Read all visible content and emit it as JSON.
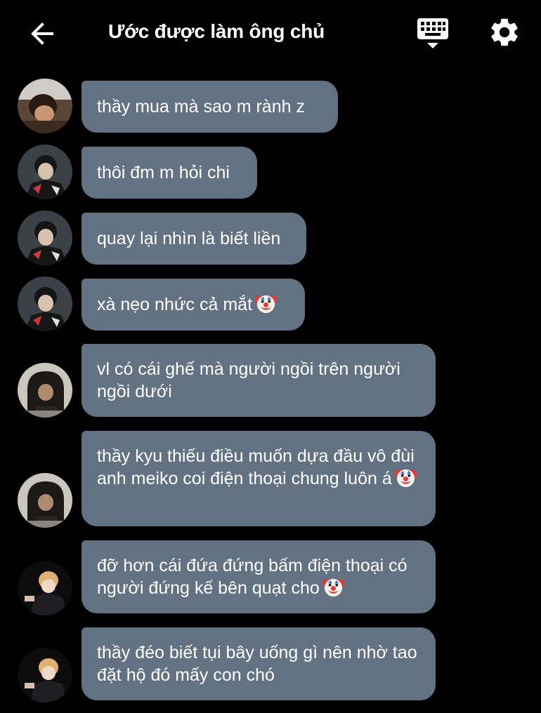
{
  "header": {
    "title": "Ước được làm ông chủ",
    "back_icon": "arrow-left-icon",
    "keyboard_icon": "keyboard-icon",
    "settings_icon": "gear-icon"
  },
  "colors": {
    "background": "#000000",
    "bubble": "#637282",
    "text": "#ffffff"
  },
  "messages": [
    {
      "text": "thầy mua mà sao m rành z",
      "emoji": "",
      "avatar": "avatar-user-1"
    },
    {
      "text": "thôi đm m hỏi chi",
      "emoji": "",
      "avatar": "avatar-user-2"
    },
    {
      "text": "quay lại nhìn là biết liền",
      "emoji": "",
      "avatar": "avatar-user-2"
    },
    {
      "text": "xà nẹo nhức cả mắt",
      "emoji": "clown-face-icon",
      "avatar": "avatar-user-2"
    },
    {
      "text": "vl có cái ghế mà người ngồi trên người ngồi dưới",
      "emoji": "",
      "avatar": "avatar-user-3"
    },
    {
      "text": "thầy kyu thiếu điều muốn dựa đầu vô đùi anh meiko coi điện thoại chung luôn á",
      "emoji": "clown-face-icon",
      "avatar": "avatar-user-3"
    },
    {
      "text": "đỡ hơn cái đứa đứng bấm điện thoại có người đứng kế bên quạt cho",
      "emoji": "clown-face-icon",
      "avatar": "avatar-user-4"
    },
    {
      "text": "thầy đéo biết tụi bây uống gì nên nhờ tao đặt hộ đó mấy con chó",
      "emoji": "",
      "avatar": "avatar-user-4"
    }
  ]
}
